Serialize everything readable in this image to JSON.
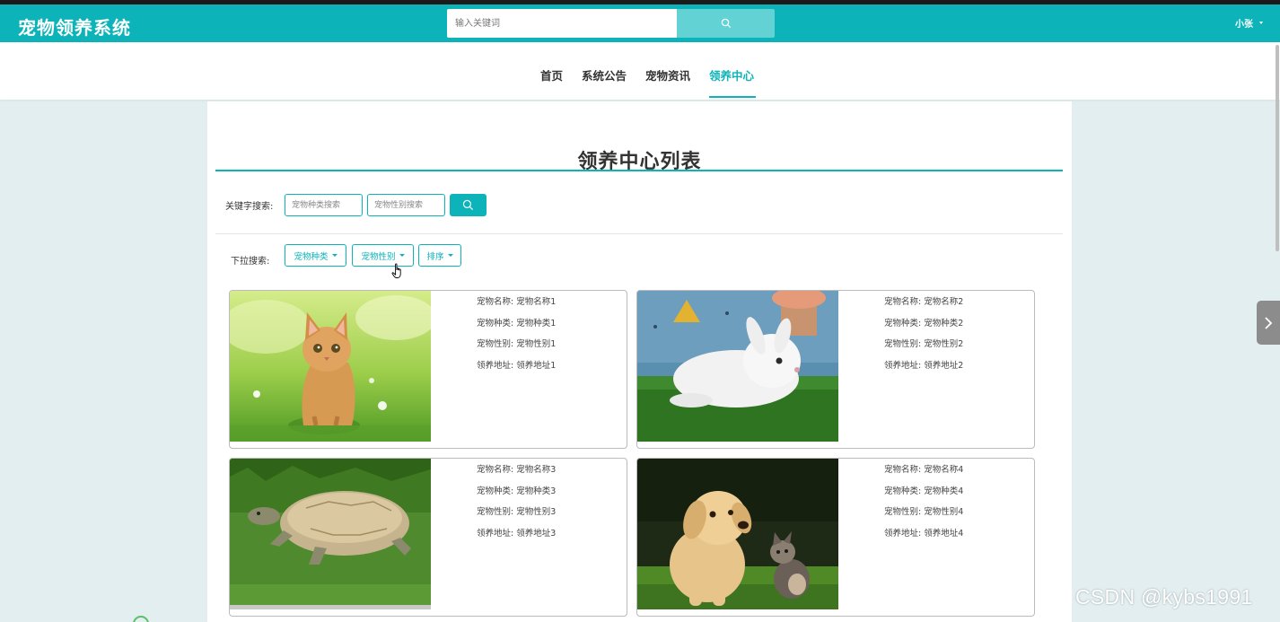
{
  "header": {
    "brand": "宠物领养系统",
    "search_placeholder": "输入关键词",
    "user": "小张"
  },
  "nav": {
    "items": [
      {
        "label": "首页",
        "active": false
      },
      {
        "label": "系统公告",
        "active": false
      },
      {
        "label": "宠物资讯",
        "active": false
      },
      {
        "label": "领养中心",
        "active": true
      }
    ]
  },
  "main": {
    "title": "领养中心列表",
    "keyword_search": {
      "label": "关键字搜索:",
      "species_placeholder": "宠物种类搜索",
      "gender_placeholder": "宠物性别搜索"
    },
    "dropdown_search": {
      "label": "下拉搜索:",
      "dropdowns": [
        "宠物种类",
        "宠物性别",
        "排序"
      ]
    },
    "cards": [
      {
        "name": "宠物名称: 宠物名称1",
        "species": "宠物种类: 宠物种类1",
        "gender": "宠物性别: 宠物性别1",
        "address": "领养地址: 领养地址1",
        "image": "kitten"
      },
      {
        "name": "宠物名称: 宠物名称2",
        "species": "宠物种类: 宠物种类2",
        "gender": "宠物性别: 宠物性别2",
        "address": "领养地址: 领养地址2",
        "image": "rabbit"
      },
      {
        "name": "宠物名称: 宠物名称3",
        "species": "宠物种类: 宠物种类3",
        "gender": "宠物性别: 宠物性别3",
        "address": "领养地址: 领养地址3",
        "image": "tortoise"
      },
      {
        "name": "宠物名称: 宠物名称4",
        "species": "宠物种类: 宠物种类4",
        "gender": "宠物性别: 宠物性别4",
        "address": "领养地址: 领养地址4",
        "image": "puppy-and-kitten"
      }
    ]
  },
  "watermark": "CSDN @kybs1991",
  "colors": {
    "primary": "#0cb3b8",
    "search_button": "#62d2d5",
    "page_background": "#e2eef0"
  }
}
